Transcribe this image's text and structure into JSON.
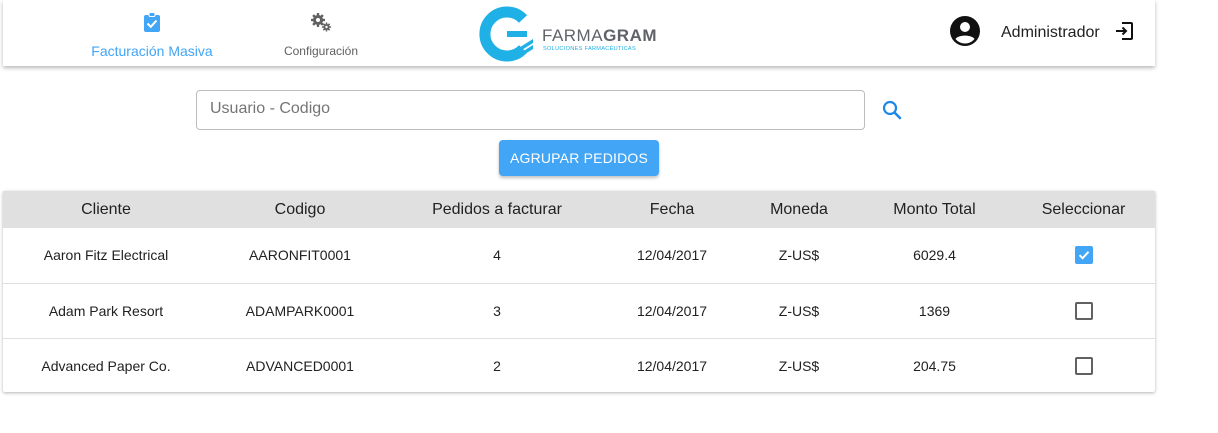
{
  "nav": {
    "billing_label": "Facturación Masiva",
    "config_label": "Configuración"
  },
  "logo": {
    "name_part1": "FARMA",
    "name_part2": "GRAM",
    "subtitle": "SOLUCIONES FARMACÉUTICAS"
  },
  "user": {
    "name": "Administrador"
  },
  "search": {
    "placeholder": "Usuario - Codigo",
    "value": ""
  },
  "group_button_label": "AGRUPAR PEDIDOS",
  "table": {
    "headers": [
      "Cliente",
      "Codigo",
      "Pedidos a facturar",
      "Fecha",
      "Moneda",
      "Monto Total",
      "Seleccionar"
    ],
    "rows": [
      {
        "cliente": "Aaron Fitz Electrical",
        "codigo": "AARONFIT0001",
        "pedidos": "4",
        "fecha": "12/04/2017",
        "moneda": "Z-US$",
        "monto": "6029.4",
        "selected": true
      },
      {
        "cliente": "Adam Park Resort",
        "codigo": "ADAMPARK0001",
        "pedidos": "3",
        "fecha": "12/04/2017",
        "moneda": "Z-US$",
        "monto": "1369",
        "selected": false
      },
      {
        "cliente": "Advanced Paper Co.",
        "codigo": "ADVANCED0001",
        "pedidos": "2",
        "fecha": "12/04/2017",
        "moneda": "Z-US$",
        "monto": "204.75",
        "selected": false
      }
    ]
  },
  "colors": {
    "accent": "#42a5f5",
    "logo_blue": "#1fb0e6",
    "header_bg": "#e0e0e0"
  },
  "icons": {
    "billing": "clipboard-check-icon",
    "config": "gears-icon",
    "user": "account-circle-icon",
    "logout": "exit-icon",
    "search": "search-icon"
  }
}
